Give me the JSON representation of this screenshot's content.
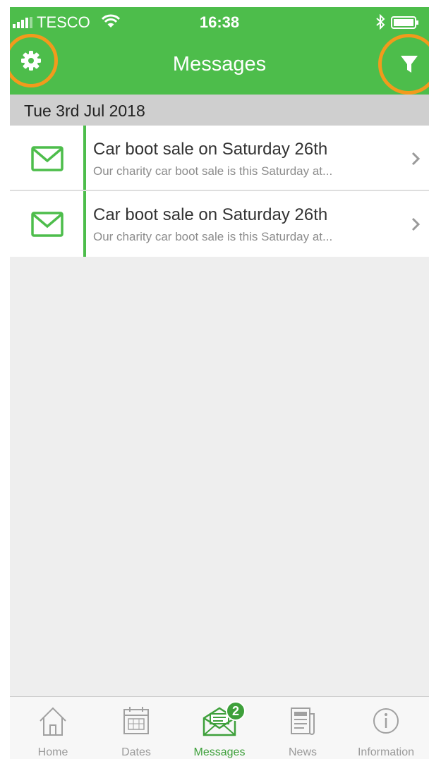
{
  "status_bar": {
    "carrier": "TESCO",
    "time": "16:38"
  },
  "nav": {
    "title": "Messages",
    "settings_icon": "gear-icon",
    "filter_icon": "filter-icon",
    "highlight_color": "#f29a1c"
  },
  "section": {
    "date": "Tue 3rd Jul 2018"
  },
  "messages": [
    {
      "icon": "envelope-icon",
      "title": "Car boot sale on Saturday 26th",
      "preview": "Our charity car boot sale is this Saturday at..."
    },
    {
      "icon": "envelope-icon",
      "title": "Car boot sale on Saturday 26th",
      "preview": "Our charity car boot sale is this Saturday at..."
    }
  ],
  "tabs": [
    {
      "label": "Home",
      "icon": "home-icon"
    },
    {
      "label": "Dates",
      "icon": "calendar-icon"
    },
    {
      "label": "Messages",
      "icon": "messages-icon",
      "badge": "2",
      "active": true
    },
    {
      "label": "News",
      "icon": "newspaper-icon"
    },
    {
      "label": "Information",
      "icon": "info-icon"
    }
  ],
  "colors": {
    "brand_green": "#4dbd4b",
    "active_tab": "#3ea03b"
  }
}
